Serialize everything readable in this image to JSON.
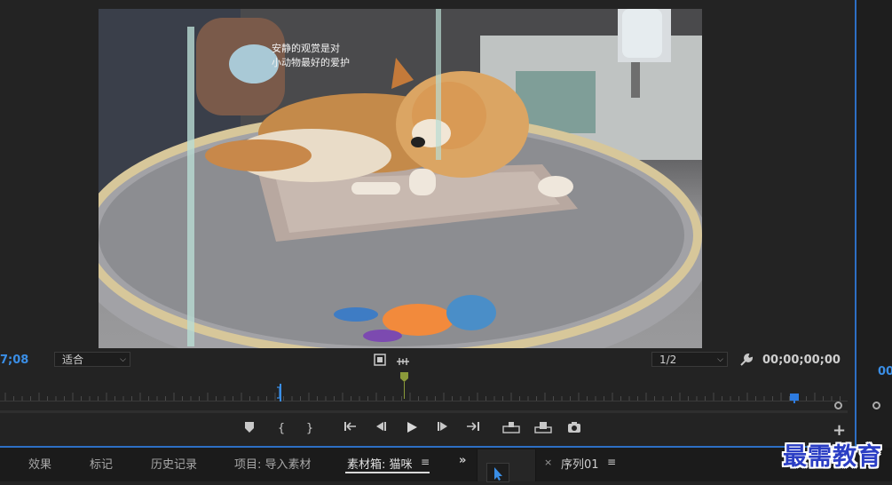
{
  "monitor": {
    "timecode_current": "7;08",
    "fit_select": "适合",
    "resolution_select": "1/2",
    "timecode_duration": "00;00;00;00",
    "right_timecode": "00"
  },
  "video": {
    "sign_text_line1": "安静的观赏是对",
    "sign_text_line2": "小动物最好的爱护"
  },
  "transport": {
    "add_marker": "⛉",
    "mark_in": "{",
    "mark_out": "}",
    "goto_in": "|←",
    "step_back": "◀|",
    "play": "▶",
    "step_forward": "|▶",
    "goto_out": "→|",
    "insert": "⎘",
    "overwrite": "⎗",
    "export_frame": "📷",
    "add_button": "+"
  },
  "bottom_tabs": {
    "effects": "效果",
    "markers": "标记",
    "history": "历史记录",
    "project": "项目: 导入素材",
    "bins": "素材箱: 猫咪",
    "menu_icon": "≡",
    "overflow": "»"
  },
  "sequence": {
    "close": "×",
    "name": "序列01",
    "menu_icon": "≡"
  },
  "watermark": "最需教育",
  "colors": {
    "accent_blue": "#2d6fc4",
    "timecode_blue": "#3a8ee6",
    "playhead_green": "#8a9a3a"
  }
}
